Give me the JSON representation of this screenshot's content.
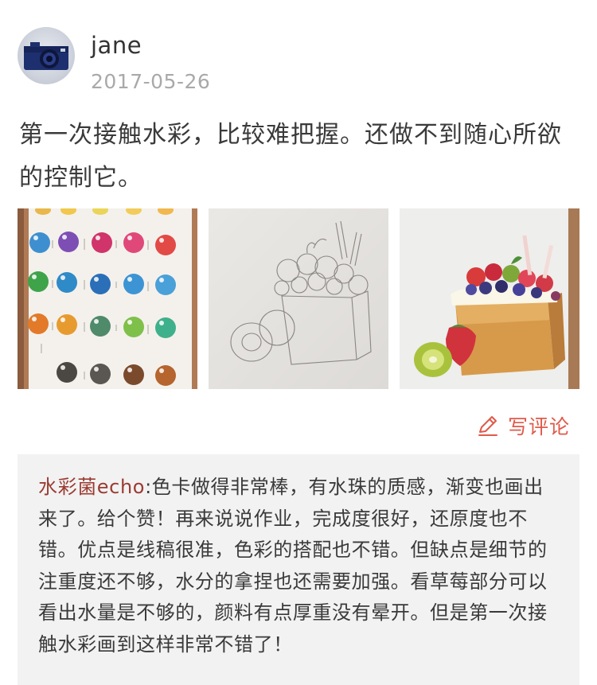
{
  "post": {
    "author": "jane",
    "date": "2017-05-26",
    "text": "第一次接触水彩，比较难把握。还做不到随心所欲的控制它。",
    "images": [
      {
        "icon": "watercolor-swatch-card-photo"
      },
      {
        "icon": "pencil-sketch-cake-photo"
      },
      {
        "icon": "watercolor-fruit-cake-photo"
      }
    ]
  },
  "actions": {
    "write_comment_label": "写评论"
  },
  "comments": [
    {
      "author": "水彩菌echo",
      "separator": ":",
      "text": "色卡做得非常棒，有水珠的质感，渐变也画出来了。给个赞！再来说说作业，完成度很好，还原度也不错。优点是线稿很准，色彩的搭配也不错。但缺点是细节的注重度还不够，水分的拿捏也还需要加强。看草莓部分可以看出水量是不够的，颜料有点厚重没有晕开。但是第一次接触水彩画到这样非常不错了！"
    }
  ],
  "colors": {
    "accent": "#e05a4a",
    "commenter_name": "#9b3b32",
    "date_gray": "#a9a9a9",
    "comment_bg": "#f2f2f2"
  }
}
